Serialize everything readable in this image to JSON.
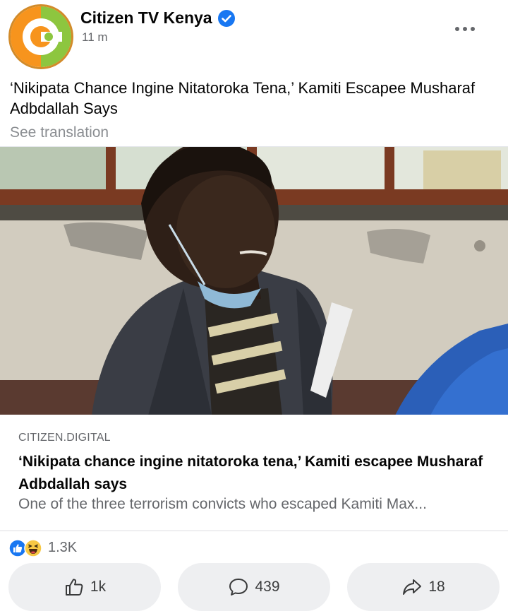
{
  "post": {
    "page_name": "Citizen TV Kenya",
    "timestamp": "11 m",
    "text": "‘Nikipata Chance Ingine Nitatoroka Tena,’ Kamiti Escapee Musharaf Adbdallah Says",
    "see_translation": "See translation"
  },
  "link_preview": {
    "domain": "CITIZEN.DIGITAL",
    "title": "‘Nikipata chance ingine nitatoroka tena,’ Kamiti escapee Musharaf Adbdallah says",
    "description": "One of the three terrorism convicts who escaped Kamiti Max..."
  },
  "reactions": {
    "count": "1.3K",
    "types": [
      "like-icon",
      "haha-icon"
    ]
  },
  "actions": {
    "like_count": "1k",
    "comment_count": "439",
    "share_count": "18"
  },
  "colors": {
    "accent": "#1877f2",
    "logo_green": "#8dc63f",
    "logo_orange": "#f7941d",
    "secondary_text": "#65676b",
    "button_bg": "#eeeff1"
  }
}
